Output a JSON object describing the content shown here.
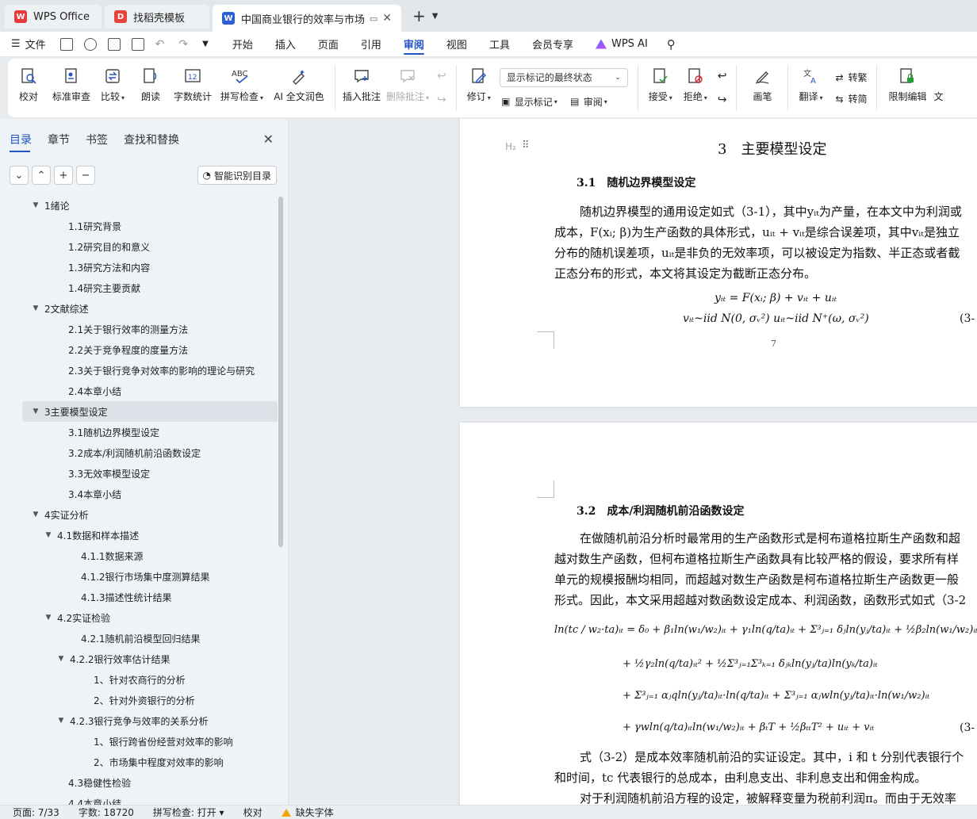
{
  "tabs": [
    {
      "label": "WPS Office",
      "icon": "wps-logo-icon",
      "color": "#e83a3a"
    },
    {
      "label": "找稻壳模板",
      "icon": "docer-icon",
      "color": "#e8423c"
    },
    {
      "label": "中国商业银行的效率与市场竞",
      "icon": "word-doc-icon",
      "color": "#2b5fd9"
    }
  ],
  "menu": {
    "file": "文件",
    "items": [
      "开始",
      "插入",
      "页面",
      "引用",
      "审阅",
      "视图",
      "工具",
      "会员专享"
    ],
    "active": "审阅",
    "ai": "WPS AI"
  },
  "ribbon": {
    "proofread": "校对",
    "std_review": "标准审查",
    "compare": "比较",
    "read_aloud": "朗读",
    "word_count": "字数统计",
    "spell_check": "拼写检查",
    "spell_check_glyph": "ABC",
    "ai_polish": "AI 全文润色",
    "insert_comment": "插入批注",
    "delete_comment": "删除批注",
    "revise": "修订",
    "markup_select": "显示标记的最终状态",
    "show_markup": "显示标记",
    "review": "审阅",
    "accept": "接受",
    "reject": "拒绝",
    "pen": "画笔",
    "translate": "翻译",
    "to_traditional": "转繁",
    "to_simplified": "转简",
    "restrict_edit": "限制编辑",
    "doc_cut": "文"
  },
  "sidebar": {
    "tabs": [
      "目录",
      "章节",
      "书签",
      "查找和替换"
    ],
    "active_tab": "目录",
    "smart_button": "智能识别目录",
    "toc": [
      {
        "label": "1绪论",
        "level": 1,
        "expanded": true
      },
      {
        "label": "1.1研究背景",
        "level": 2
      },
      {
        "label": "1.2研究目的和意义",
        "level": 2
      },
      {
        "label": "1.3研究方法和内容",
        "level": 2
      },
      {
        "label": "1.4研究主要贡献",
        "level": 2
      },
      {
        "label": "2文献综述",
        "level": 1,
        "expanded": true
      },
      {
        "label": "2.1关于银行效率的测量方法",
        "level": 2
      },
      {
        "label": "2.2关于竞争程度的度量方法",
        "level": 2
      },
      {
        "label": "2.3关于银行竞争对效率的影响的理论与研究",
        "level": 2
      },
      {
        "label": "2.4本章小结",
        "level": 2
      },
      {
        "label": "3主要模型设定",
        "level": 1,
        "expanded": true,
        "selected": true
      },
      {
        "label": "3.1随机边界模型设定",
        "level": 2
      },
      {
        "label": "3.2成本/利润随机前沿函数设定",
        "level": 2
      },
      {
        "label": "3.3无效率模型设定",
        "level": 2
      },
      {
        "label": "3.4本章小结",
        "level": 2
      },
      {
        "label": "4实证分析",
        "level": 1,
        "expanded": true
      },
      {
        "label": "4.1数据和样本描述",
        "level": 2,
        "expanded": true
      },
      {
        "label": "4.1.1数据来源",
        "level": 3
      },
      {
        "label": "4.1.2银行市场集中度测算结果",
        "level": 3
      },
      {
        "label": "4.1.3描述性统计结果",
        "level": 3
      },
      {
        "label": "4.2实证检验",
        "level": 2,
        "expanded": true
      },
      {
        "label": "4.2.1随机前沿模型回归结果",
        "level": 3
      },
      {
        "label": "4.2.2银行效率估计结果",
        "level": 3,
        "expanded": true
      },
      {
        "label": "1、针对农商行的分析",
        "level": 4
      },
      {
        "label": "2、针对外资银行的分析",
        "level": 4
      },
      {
        "label": "4.2.3银行竞争与效率的关系分析",
        "level": 3,
        "expanded": true
      },
      {
        "label": "1、银行跨省份经营对效率的影响",
        "level": 4
      },
      {
        "label": "2、市场集中程度对效率的影响",
        "level": 4
      },
      {
        "label": "4.3稳健性检验",
        "level": 2
      },
      {
        "label": "4.4本章小结",
        "level": 2
      }
    ]
  },
  "document": {
    "heading_marker": "H₂",
    "page1": {
      "chapter_title": "3　主要模型设定",
      "section_title": "3.1　随机边界模型设定",
      "para_lines": [
        "随机边界模型的通用设定如式（3-1），其中yᵢₜ为产量，在本文中为利润或",
        "成本，F(xᵢ; β)为生产函数的具体形式，uᵢₜ + vᵢₜ是综合误差项，其中vᵢₜ是独立",
        "分布的随机误差项，uᵢₜ是非负的无效率项，可以被设定为指数、半正态或者截",
        "正态分布的形式，本文将其设定为截断正态分布。"
      ],
      "eq1": "yᵢₜ = F(xᵢ; β) + vᵢₜ + uᵢₜ",
      "eq2": "vᵢₜ~iid N(0, σᵥ²)    uᵢₜ~iid N⁺(ω, σᵥ²)",
      "eq_number": "(3-",
      "page_number": "7"
    },
    "page2": {
      "section_title": "3.2　成本/利润随机前沿函数设定",
      "para_lines": [
        "在做随机前沿分析时最常用的生产函数形式是柯布道格拉斯生产函数和超",
        "越对数生产函数，但柯布道格拉斯生产函数具有比较严格的假设，要求所有样",
        "单元的规模报酬均相同，而超越对数生产函数是柯布道格拉斯生产函数更一般",
        "形式。因此，本文采用超越对数函数设定成本、利润函数，函数形式如式（3-2"
      ],
      "formula_lines": [
        "ln(tc / w₂·ta)ᵢₜ = δ₀ + β₁ln(w₁/w₂)ᵢₜ + γ₁ln(q/ta)ᵢₜ + Σ³ⱼ₌₁ δⱼln(yⱼ/ta)ᵢₜ + ½β₂ln(w₁/w₂)ᵢₜ²",
        "+ ½γ₂ln(q/ta)ᵢₜ² + ½Σ³ⱼ₌₁Σ³ₖ₌₁ δⱼₖln(yⱼ/ta)ln(yₖ/ta)ᵢₜ",
        "+ Σ³ⱼ₌₁ αⱼqln(yⱼ/ta)ᵢₜ·ln(q/ta)ᵢₜ + Σ³ⱼ₌₁ αⱼwln(yⱼ/ta)ᵢₜ·ln(w₁/w₂)ᵢₜ",
        "+ γwln(q/ta)ᵢₜln(w₁/w₂)ᵢₜ + βₜT + ½βₜₜT² + uᵢₜ + vᵢₜ"
      ],
      "eq_number": "(3-",
      "after_lines": [
        "式（3-2）是成本效率随机前沿的实证设定。其中，i 和 t 分别代表银行个",
        "和时间，tc 代表银行的总成本，由利息支出、非利息支出和佣金构成。",
        "对于利润随机前沿方程的设定，被解释变量为税前利润π。而由于无效率"
      ]
    }
  },
  "status": {
    "page": "页面: 7/33",
    "words": "字数: 18720",
    "spell": "拼写检查: 打开",
    "proof": "校对",
    "missing_font": "缺失字体"
  },
  "colors": {
    "accent": "#2354c4",
    "wps_red": "#e83a3a",
    "warn": "#f0a500"
  }
}
